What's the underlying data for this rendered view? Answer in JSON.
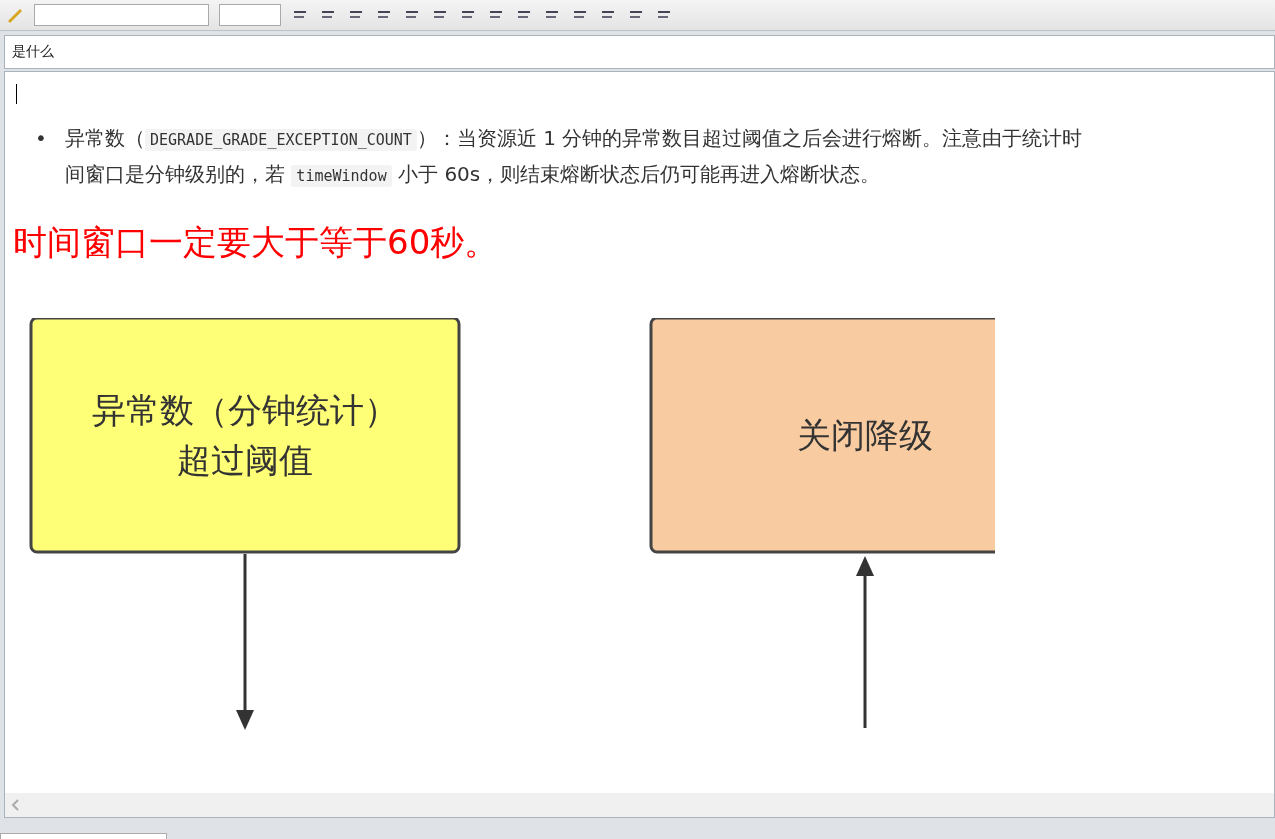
{
  "title_field": {
    "value": "是什么"
  },
  "bullets": [
    {
      "marker": "•",
      "segments": [
        {
          "kind": "text",
          "text": "异常数（"
        },
        {
          "kind": "code",
          "text": "DEGRADE_GRADE_EXCEPTION_COUNT"
        },
        {
          "kind": "text",
          "text": "）：当资源近 1 分钟的异常数目超过阈值之后会进行熔断。注意由于统计时间窗口是分钟级别的，若 "
        },
        {
          "kind": "code",
          "text": "timeWindow"
        },
        {
          "kind": "text",
          "text": " 小于 60s，则结束熔断状态后仍可能再进入熔断状态。"
        }
      ]
    }
  ],
  "highlight": "时间窗口一定要大于等于60秒。",
  "diagram": {
    "boxes": [
      {
        "kind": "trigger",
        "lines": [
          "异常数（分钟统计）",
          "超过阈值"
        ],
        "color": "#ffff77"
      },
      {
        "kind": "close",
        "lines": [
          "关闭降级"
        ],
        "color": "#f8cba0"
      }
    ]
  }
}
